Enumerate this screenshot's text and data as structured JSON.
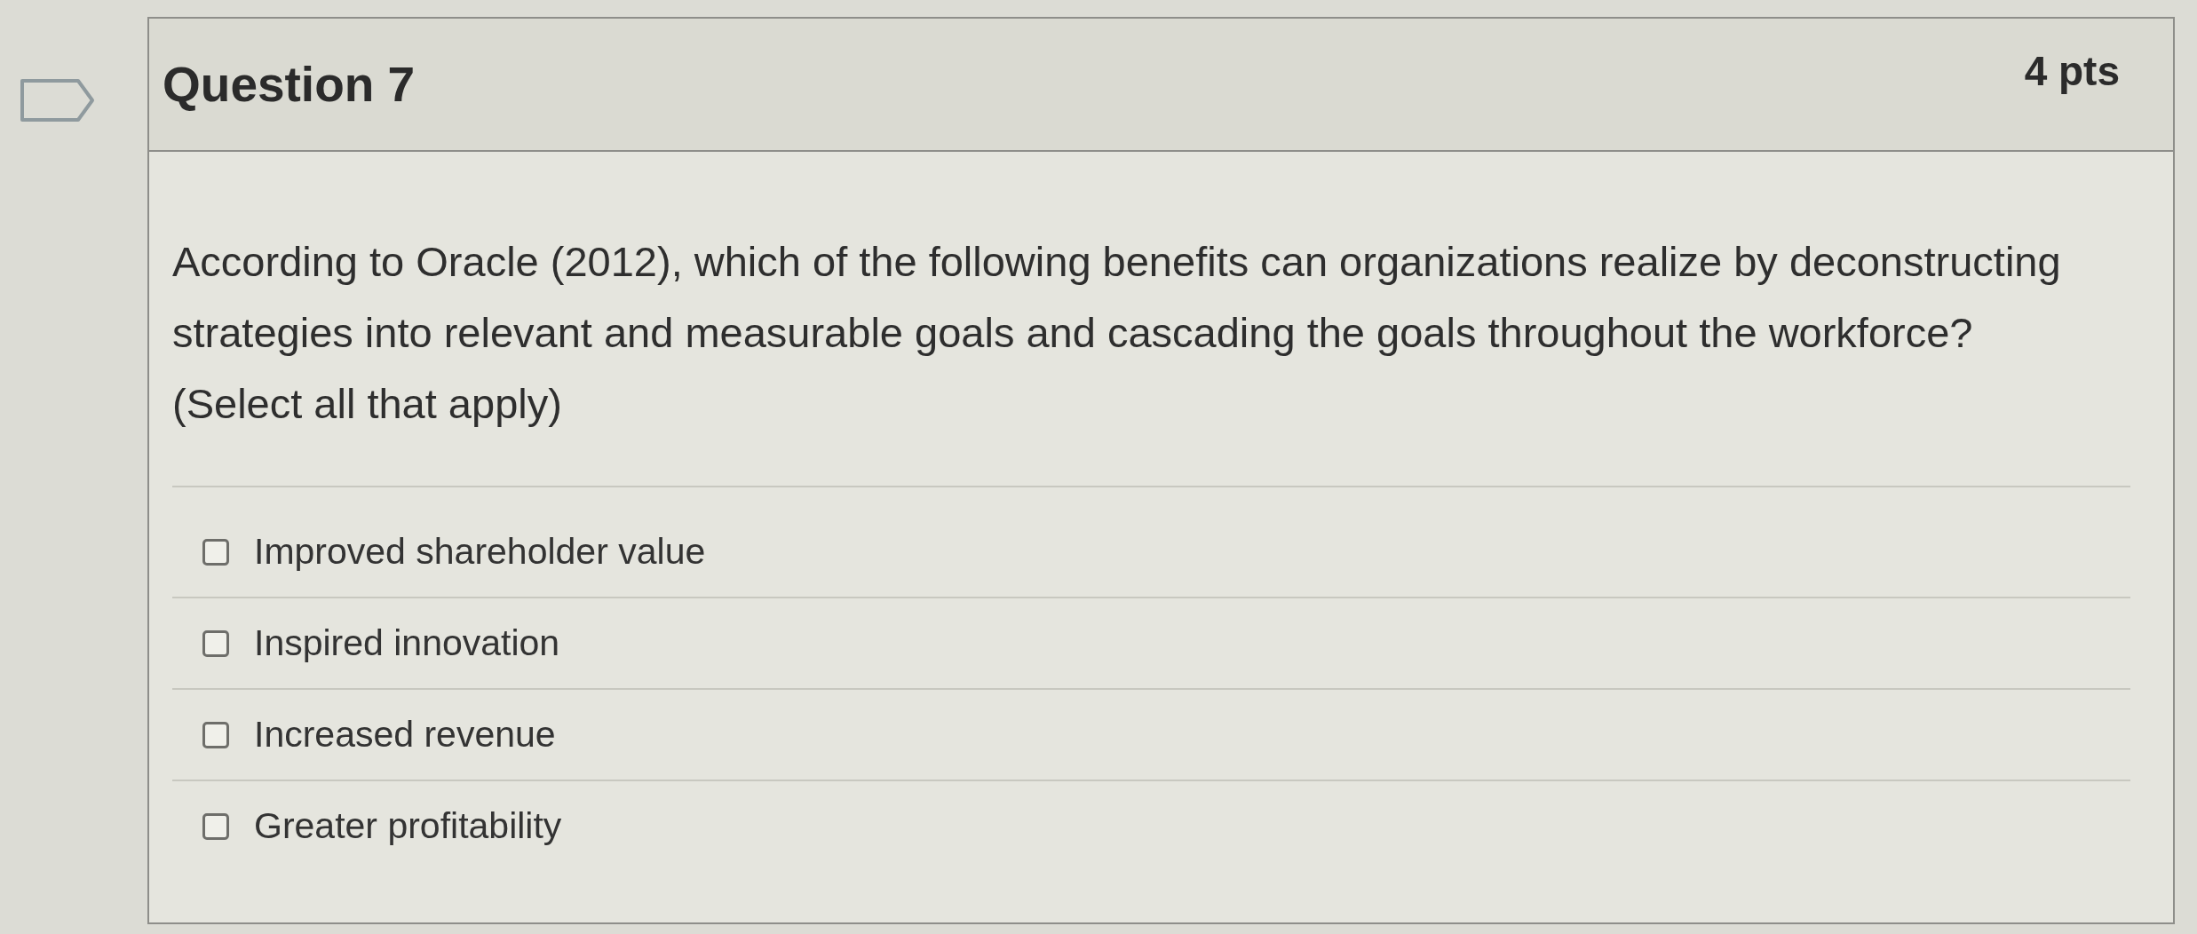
{
  "question": {
    "title": "Question 7",
    "points": "4 pts",
    "prompt": "According to Oracle (2012), which of the following benefits can organizations realize by deconstructing strategies into relevant and measurable goals and cascading the goals throughout the workforce?",
    "instruction": "(Select all that apply)"
  },
  "options": [
    {
      "label": "Improved shareholder value",
      "checked": false
    },
    {
      "label": "Inspired innovation",
      "checked": false
    },
    {
      "label": "Increased revenue",
      "checked": false
    },
    {
      "label": "Greater profitability",
      "checked": false
    }
  ]
}
